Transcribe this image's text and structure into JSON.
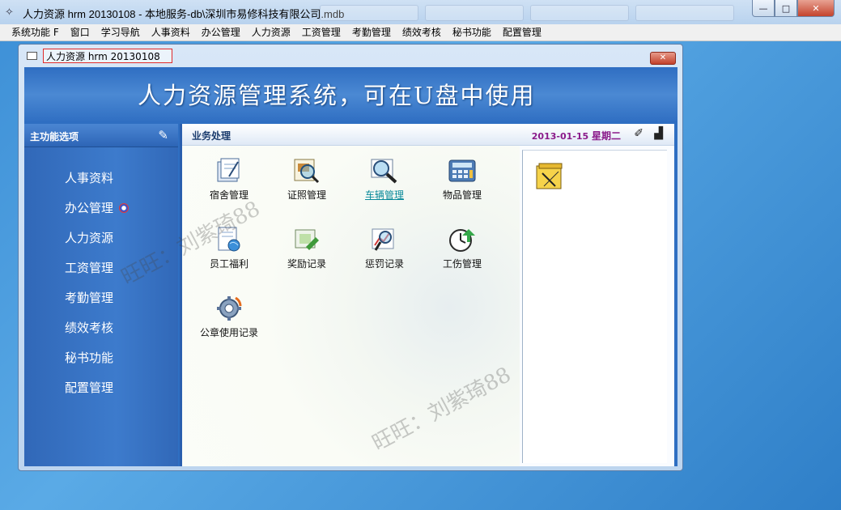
{
  "window": {
    "title": "人力资源 hrm 20130108 - 本地服务-db\\深圳市易修科技有限公司.mdb",
    "minimize": "—",
    "maximize": "□",
    "close": "✕"
  },
  "menubar": [
    "系统功能 F",
    "窗口",
    "学习导航",
    "人事资料",
    "办公管理",
    "人力资源",
    "工资管理",
    "考勤管理",
    "绩效考核",
    "秘书功能",
    "配置管理"
  ],
  "child": {
    "title": "人力资源 hrm 20130108",
    "close": "✕",
    "banner": "人力资源管理系统，可在U盘中使用"
  },
  "sidebar": {
    "title": "主功能选项",
    "items": [
      "人事资料",
      "办公管理",
      "人力资源",
      "工资管理",
      "考勤管理",
      "绩效考核",
      "秘书功能",
      "配置管理"
    ]
  },
  "main": {
    "title": "业务处理",
    "date": "2013-01-15",
    "weekday": "星期二",
    "tiles": [
      "宿舍管理",
      "证照管理",
      "车辆管理",
      "物品管理",
      "员工福利",
      "奖励记录",
      "惩罚记录",
      "工伤管理",
      "公章使用记录"
    ]
  },
  "watermark": "旺旺：刘紫琦88",
  "icons": {
    "app": "app-icon",
    "sidebar_pin": "pin-icon",
    "header_tools": [
      "wand-icon",
      "chart-icon"
    ]
  }
}
